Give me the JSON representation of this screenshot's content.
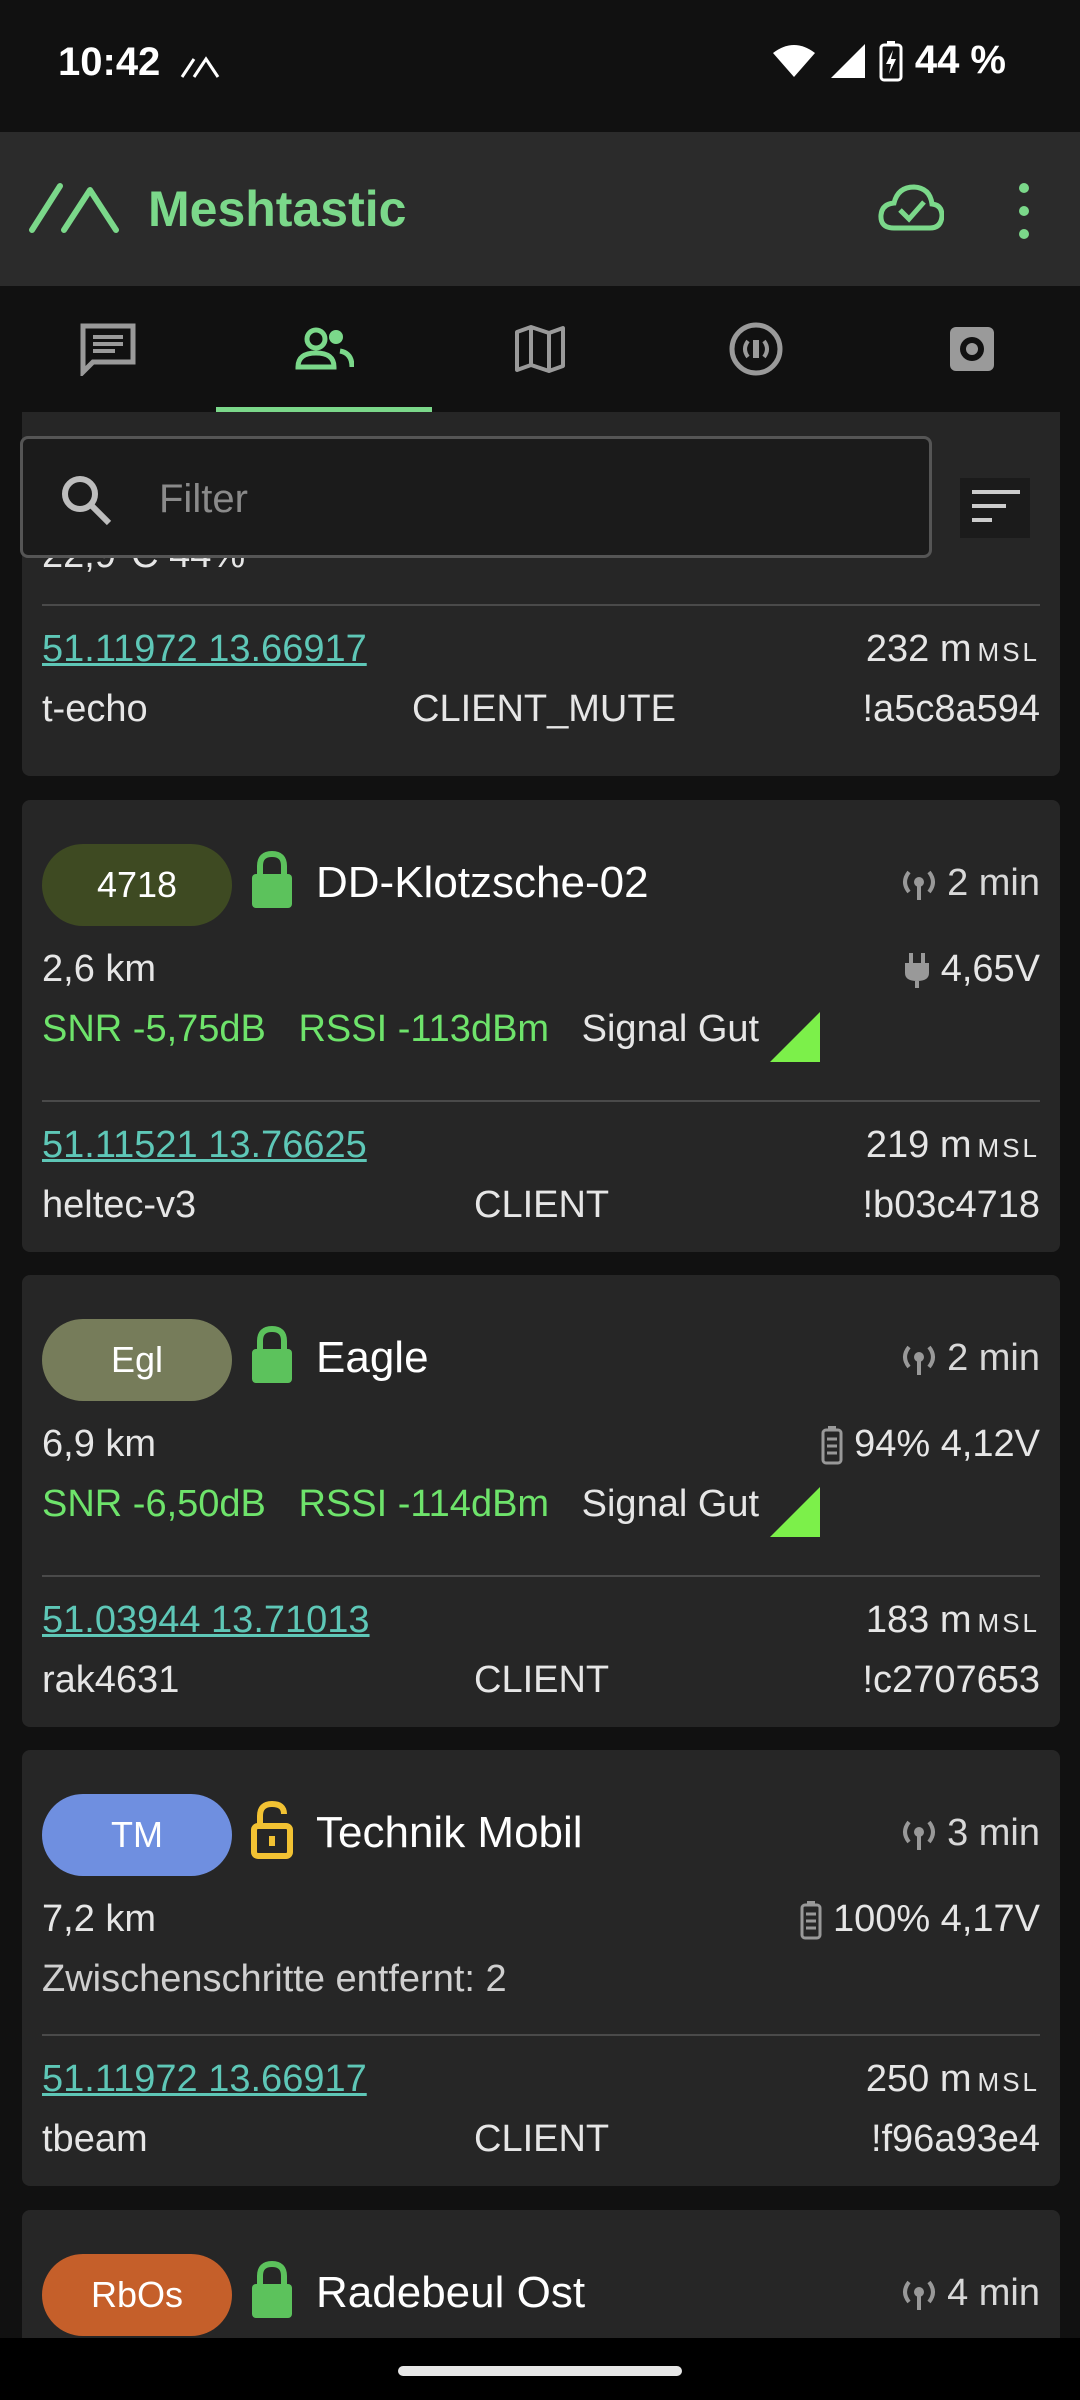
{
  "status_bar": {
    "time": "10:42",
    "battery": "44 %"
  },
  "app": {
    "title": "Meshtastic",
    "accent": "#7bd88a"
  },
  "tabs": [
    {
      "name": "messages"
    },
    {
      "name": "nodes",
      "active": true
    },
    {
      "name": "map"
    },
    {
      "name": "channel"
    },
    {
      "name": "settings"
    }
  ],
  "filter": {
    "placeholder": "Filter"
  },
  "partial_node": {
    "env": "22,9°C 44%",
    "coords": "51.11972 13.66917",
    "altitude": "232 m",
    "msl": "MSL",
    "hardware": "t-echo",
    "role": "CLIENT_MUTE",
    "id": "!a5c8a594"
  },
  "nodes": [
    {
      "short": "4718",
      "badge_color": "#3e4a22",
      "name": "DD-Klotzsche-02",
      "locked": true,
      "heard": "2 min",
      "distance": "2,6 km",
      "power": "4,65V",
      "snr": "SNR -5,75dB",
      "rssi": "RSSI -113dBm",
      "signal": "Signal Gut",
      "coords": "51.11521 13.76625",
      "altitude": "219 m",
      "msl": "MSL",
      "hardware": "heltec-v3",
      "role": "CLIENT",
      "id": "!b03c4718"
    },
    {
      "short": "Egl",
      "badge_color": "#767c5a",
      "name": "Eagle",
      "locked": true,
      "heard": "2 min",
      "distance": "6,9 km",
      "power": "94% 4,12V",
      "snr": "SNR -6,50dB",
      "rssi": "RSSI -114dBm",
      "signal": "Signal Gut",
      "coords": "51.03944 13.71013",
      "altitude": "183 m",
      "msl": "MSL",
      "hardware": "rak4631",
      "role": "CLIENT",
      "id": "!c2707653"
    },
    {
      "short": "TM",
      "badge_color": "#6f8fe0",
      "name": "Technik Mobil",
      "locked": false,
      "heard": "3 min",
      "distance": "7,2 km",
      "power": "100% 4,17V",
      "hops": "Zwischenschritte entfernt: 2",
      "coords": "51.11972 13.66917",
      "altitude": "250 m",
      "msl": "MSL",
      "hardware": "tbeam",
      "role": "CLIENT",
      "id": "!f96a93e4"
    },
    {
      "short": "RbOs",
      "badge_color": "#c55f2a",
      "name": "Radebeul Ost",
      "locked": true,
      "heard": "4 min"
    }
  ]
}
